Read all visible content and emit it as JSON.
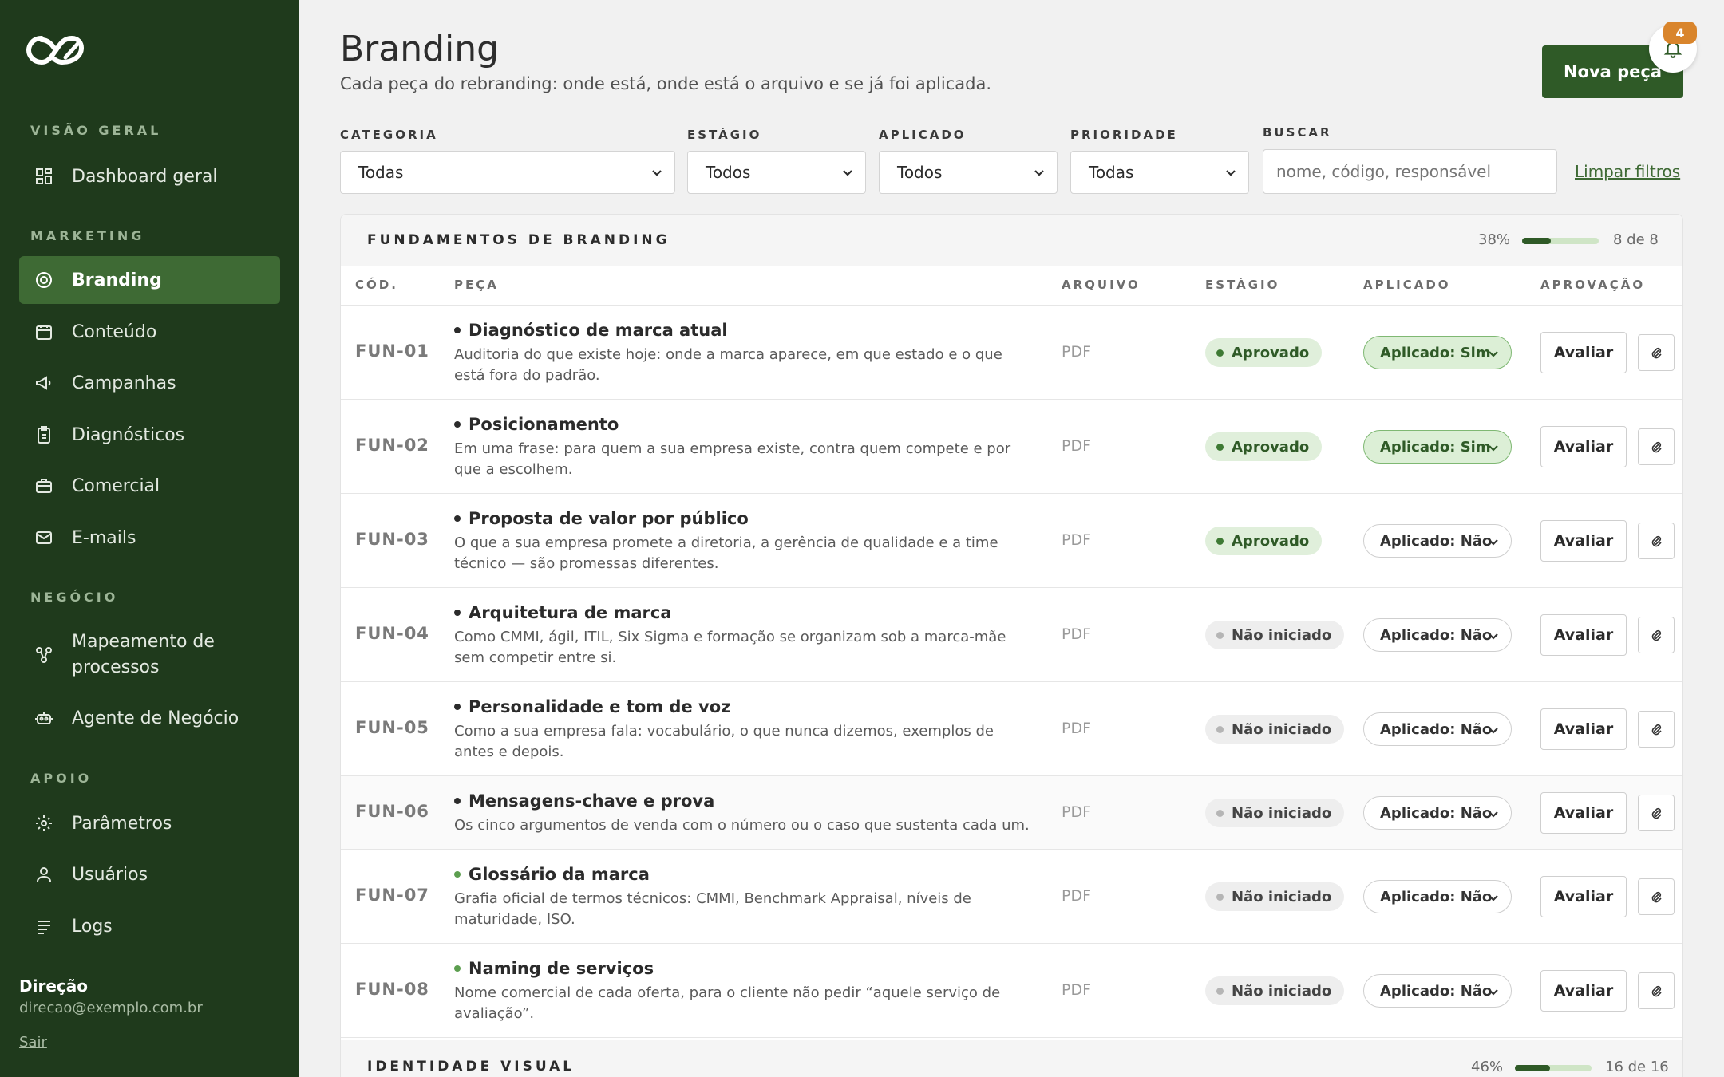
{
  "sidebar": {
    "sections": [
      {
        "label": "VISÃO GERAL"
      },
      {
        "label": "MARKETING"
      },
      {
        "label": "NEGÓCIO"
      },
      {
        "label": "APOIO"
      }
    ],
    "items": [
      {
        "label": "Dashboard geral",
        "icon": "dashboard-icon"
      },
      {
        "label": "Branding",
        "icon": "target-icon",
        "active": true
      },
      {
        "label": "Conteúdo",
        "icon": "calendar-icon"
      },
      {
        "label": "Campanhas",
        "icon": "megaphone-icon"
      },
      {
        "label": "Diagnósticos",
        "icon": "clipboard-icon"
      },
      {
        "label": "Comercial",
        "icon": "briefcase-icon"
      },
      {
        "label": "E-mails",
        "icon": "mail-icon"
      },
      {
        "label": "Mapeamento de processos",
        "icon": "flow-icon"
      },
      {
        "label": "Agente de Negócio",
        "icon": "robot-icon"
      },
      {
        "label": "Parâmetros",
        "icon": "gear-icon"
      },
      {
        "label": "Usuários",
        "icon": "user-icon"
      },
      {
        "label": "Logs",
        "icon": "list-icon"
      }
    ],
    "user": {
      "name": "Direção",
      "email": "direcao@exemplo.com.br",
      "logout": "Sair"
    }
  },
  "header": {
    "title": "Branding",
    "subtitle": "Cada peça do rebranding: onde está, onde está o arquivo e se já foi aplicada.",
    "new_button": "Nova peça",
    "notifications": "4"
  },
  "filters": {
    "categoria": {
      "label": "CATEGORIA",
      "value": "Todas"
    },
    "estagio": {
      "label": "ESTÁGIO",
      "value": "Todos"
    },
    "aplicado": {
      "label": "APLICADO",
      "value": "Todos"
    },
    "prioridade": {
      "label": "PRIORIDADE",
      "value": "Todas"
    },
    "buscar": {
      "label": "BUSCAR",
      "placeholder": "nome, código, responsável"
    },
    "clear": "Limpar filtros"
  },
  "group1": {
    "name": "FUNDAMENTOS DE BRANDING",
    "percent": "38%",
    "progress": 0.38,
    "count": "8 de 8"
  },
  "columns": {
    "code": "CÓD.",
    "piece": "PEÇA",
    "file": "ARQUIVO",
    "stage": "ESTÁGIO",
    "applied": "APLICADO",
    "approval": "APROVAÇÃO"
  },
  "rows": [
    {
      "code": "FUN-01",
      "title": "Diagnóstico de marca atual",
      "desc": "Auditoria do que existe hoje: onde a marca aparece, em que estado e o que está fora do padrão.",
      "file": "PDF",
      "status": "Aprovado",
      "applied": "Aplicado: Sim",
      "evaluate": "Avaliar"
    },
    {
      "code": "FUN-02",
      "title": "Posicionamento",
      "desc": "Em uma frase: para quem a sua empresa existe, contra quem compete e por que a escolhem.",
      "file": "PDF",
      "status": "Aprovado",
      "applied": "Aplicado: Sim",
      "evaluate": "Avaliar"
    },
    {
      "code": "FUN-03",
      "title": "Proposta de valor por público",
      "desc": "O que a sua empresa promete a diretoria, a gerência de qualidade e a time técnico — são promessas diferentes.",
      "file": "PDF",
      "status": "Aprovado",
      "applied": "Aplicado: Não",
      "evaluate": "Avaliar"
    },
    {
      "code": "FUN-04",
      "title": "Arquitetura de marca",
      "desc": "Como CMMI, ágil, ITIL, Six Sigma e formação se organizam sob a marca-mãe sem competir entre si.",
      "file": "PDF",
      "status": "Não iniciado",
      "applied": "Aplicado: Não",
      "evaluate": "Avaliar"
    },
    {
      "code": "FUN-05",
      "title": "Personalidade e tom de voz",
      "desc": "Como a sua empresa fala: vocabulário, o que nunca dizemos, exemplos de antes e depois.",
      "file": "PDF",
      "status": "Não iniciado",
      "applied": "Aplicado: Não",
      "evaluate": "Avaliar"
    },
    {
      "code": "FUN-06",
      "title": "Mensagens-chave e prova",
      "desc": "Os cinco argumentos de venda com o número ou o caso que sustenta cada um.",
      "file": "PDF",
      "status": "Não iniciado",
      "applied": "Aplicado: Não",
      "evaluate": "Avaliar"
    },
    {
      "code": "FUN-07",
      "title": "Glossário da marca",
      "desc": "Grafia oficial de termos técnicos: CMMI, Benchmark Appraisal, níveis de maturidade, ISO.",
      "file": "PDF",
      "status": "Não iniciado",
      "applied": "Aplicado: Não",
      "evaluate": "Avaliar"
    },
    {
      "code": "FUN-08",
      "title": "Naming de serviços",
      "desc": "Nome comercial de cada oferta, para o cliente não pedir “aquele serviço de avaliação”.",
      "file": "PDF",
      "status": "Não iniciado",
      "applied": "Aplicado: Não",
      "evaluate": "Avaliar"
    }
  ],
  "group2": {
    "name": "IDENTIDADE VISUAL",
    "percent": "46%",
    "progress": 0.46,
    "count": "16 de 16"
  }
}
